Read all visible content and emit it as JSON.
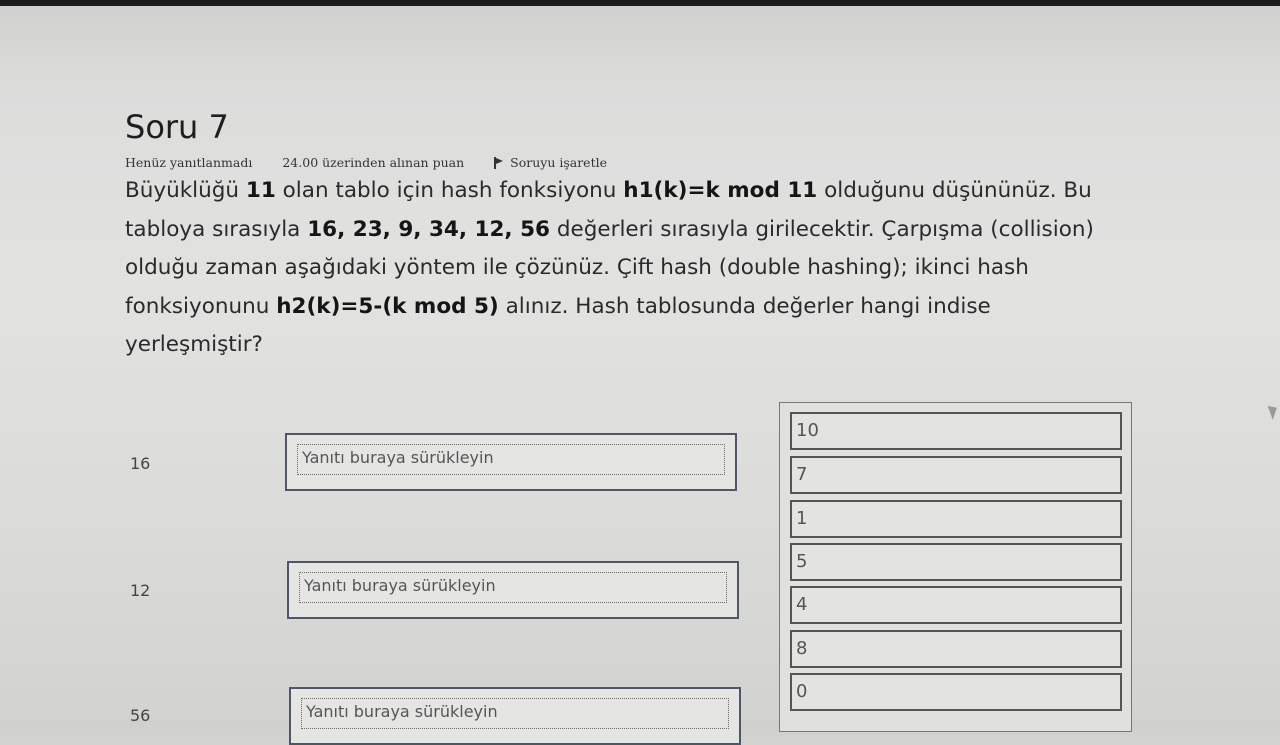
{
  "question": {
    "title": "Soru 7",
    "status": "Henüz yanıtlanmadı",
    "points": "24.00 üzerinden alınan puan",
    "flag_label": "Soruyu işaretle",
    "text_parts": [
      "Büyüklüğü ",
      "11",
      " olan tablo için hash fonksiyonu ",
      "h1(k)=k mod 11",
      " olduğunu düşününüz. Bu tabloya sırasıyla ",
      "16, 23, 9, 34, 12, 56",
      "  değerleri sırasıyla girilecektir. Çarpışma (collision) olduğu zaman aşağıdaki yöntem ile çözünüz. Çift hash  (double hashing); ikinci hash fonksiyonunu ",
      "h2(k)=5-(k mod 5)",
      " alınız.  Hash tablosunda değerler  hangi indise yerleşmiştir?"
    ]
  },
  "drop_placeholder": "Yanıtı buraya sürükleyin",
  "rows": [
    {
      "label": "16"
    },
    {
      "label": "12"
    },
    {
      "label": "56"
    }
  ],
  "choices": [
    "10",
    "7",
    "1",
    "5",
    "4",
    "8",
    "0"
  ]
}
